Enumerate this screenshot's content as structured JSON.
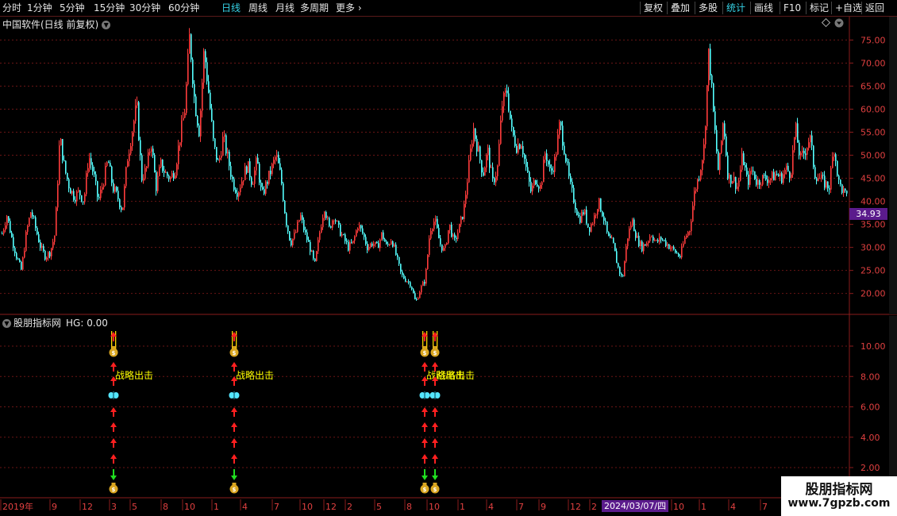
{
  "toolbar": {
    "left_items": [
      {
        "label": "分时",
        "active": false
      },
      {
        "label": "1分钟",
        "active": false
      },
      {
        "label": "5分钟",
        "active": false
      },
      {
        "label": "15分钟",
        "active": false
      },
      {
        "label": "30分钟",
        "active": false
      },
      {
        "label": "60分钟",
        "active": false
      },
      {
        "label": "日线",
        "active": true
      },
      {
        "label": "周线",
        "active": false
      },
      {
        "label": "月线",
        "active": false
      },
      {
        "label": "多周期",
        "active": false
      },
      {
        "label": "更多",
        "active": false
      }
    ],
    "right_items": [
      {
        "label": "复权",
        "active": false
      },
      {
        "label": "叠加",
        "active": false
      },
      {
        "label": "多股",
        "active": false
      },
      {
        "label": "统计",
        "active": true
      },
      {
        "label": "画线",
        "active": false
      },
      {
        "label": "F10",
        "active": false
      },
      {
        "label": "标记",
        "active": false
      },
      {
        "label": "+自选",
        "active": false
      },
      {
        "label": "返回",
        "active": false
      }
    ]
  },
  "main_chart": {
    "title": "中国软件(日线 前复权)",
    "axis_labels": [
      "75.00",
      "70.00",
      "65.00",
      "60.00",
      "55.00",
      "50.00",
      "45.00",
      "40.00",
      "35.00",
      "30.00",
      "25.00",
      "20.00"
    ],
    "current_price": "34.93"
  },
  "indicator": {
    "title": "股朋指标网",
    "hg_label": "HG: 0.00",
    "axis_labels": [
      "10.00",
      "8.00",
      "6.00",
      "4.00",
      "2.00"
    ],
    "signal_text": "战略出击",
    "signal_x": [
      143,
      295,
      535,
      548
    ]
  },
  "time_axis": {
    "labels": [
      "2019年",
      "9",
      "12",
      "3",
      "5",
      "8",
      "10",
      "1",
      "4",
      "7",
      "10",
      "12",
      "2",
      "5",
      "8",
      "10",
      "1",
      "4",
      "7",
      "9",
      "12",
      "2",
      "10",
      "1",
      "4",
      "7"
    ],
    "selected_date": "2024/03/07/四"
  },
  "watermark": {
    "line1": "股朋指标网",
    "line2": "www.7gpzb.com"
  },
  "colors": {
    "up": "#ff3c3c",
    "down": "#54ffff",
    "grid": "#6a1515",
    "accent": "#36d2e6",
    "tag_bg": "#5b1b8c",
    "signal_text": "#ffff00"
  },
  "chart_data": {
    "type": "candlestick",
    "ylim": [
      17,
      78
    ],
    "closes": [
      33.0,
      37.0,
      32.0,
      28.0,
      25.0,
      33.0,
      38.0,
      34.0,
      30.0,
      28.0,
      29.0,
      33.0,
      54.0,
      47.0,
      43.0,
      41.0,
      42.0,
      40.0,
      50.0,
      46.0,
      40.0,
      44.0,
      49.0,
      43.0,
      41.0,
      38.0,
      49.0,
      55.0,
      61.0,
      45.0,
      47.0,
      53.0,
      43.0,
      48.0,
      46.0,
      45.0,
      47.0,
      54.0,
      60.0,
      76.0,
      62.0,
      55.0,
      73.0,
      63.0,
      52.0,
      48.0,
      54.0,
      49.0,
      44.0,
      42.0,
      45.0,
      48.0,
      44.0,
      49.0,
      41.0,
      44.0,
      47.0,
      50.0,
      45.0,
      36.0,
      31.0,
      33.0,
      37.0,
      33.0,
      30.0,
      26.0,
      33.0,
      39.0,
      34.0,
      37.0,
      34.0,
      32.0,
      30.0,
      31.0,
      35.0,
      33.0,
      30.0,
      31.0,
      30.0,
      33.0,
      30.0,
      32.0,
      28.0,
      24.0,
      23.0,
      22.0,
      18.0,
      21.0,
      23.0,
      34.0,
      36.0,
      31.0,
      29.0,
      35.0,
      31.0,
      34.0,
      38.0,
      47.0,
      56.0,
      51.0,
      46.0,
      51.0,
      44.0,
      47.0,
      61.0,
      64.0,
      55.0,
      52.0,
      53.0,
      47.0,
      42.0,
      45.0,
      43.0,
      51.0,
      46.0,
      49.0,
      57.0,
      51.0,
      44.0,
      40.0,
      36.0,
      38.0,
      34.0,
      36.0,
      40.0,
      37.0,
      32.0,
      31.0,
      26.0,
      23.0,
      32.0,
      36.0,
      32.0,
      30.0,
      31.0,
      33.0,
      31.0,
      32.0,
      31.0,
      30.0,
      29.0,
      28.0,
      32.0,
      34.0,
      42.0,
      46.0,
      52.0,
      73.0,
      58.0,
      46.0,
      58.0,
      45.0,
      45.0,
      43.0,
      50.0,
      44.0,
      47.0,
      44.0,
      45.0,
      45.0,
      45.0,
      46.0,
      45.0,
      47.0,
      46.0,
      56.0,
      49.0,
      51.0,
      54.0,
      46.0,
      45.0,
      44.0,
      43.0,
      52.0,
      44.0,
      42.0,
      40.0
    ],
    "indicator": {
      "ylim": [
        0,
        12
      ],
      "signal_text": "战略出击"
    }
  }
}
